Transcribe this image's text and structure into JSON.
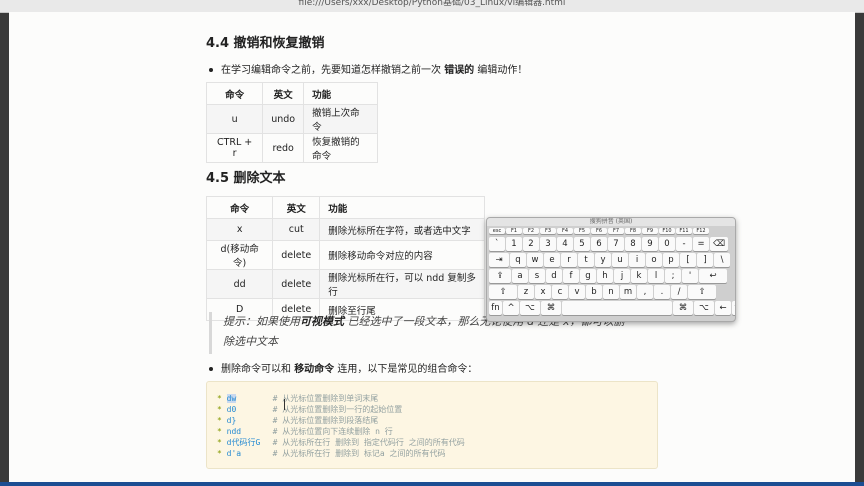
{
  "browser": {
    "url": "file:///Users/xxx/Desktop/Python基础/03_Linux/vi编辑器.html"
  },
  "section44": {
    "title": "4.4 撤销和恢复撤销",
    "bullet_pre": "在学习编辑命令之前，先要知道怎样撤销之前一次",
    "bullet_bold": "错误的",
    "bullet_post": "编辑动作！",
    "headers": [
      "命令",
      "英文",
      "功能"
    ],
    "rows": [
      [
        "u",
        "undo",
        "撤销上次命令"
      ],
      [
        "CTRL + r",
        "redo",
        "恢复撤销的命令"
      ]
    ]
  },
  "section45": {
    "title": "4.5 删除文本",
    "headers": [
      "命令",
      "英文",
      "功能"
    ],
    "rows": [
      [
        "x",
        "cut",
        "删除光标所在字符，或者选中文字"
      ],
      [
        "d(移动命令)",
        "delete",
        "删除移动命令对应的内容"
      ],
      [
        "dd",
        "delete",
        "删除光标所在行，可以 ndd 复制多行"
      ],
      [
        "D",
        "delete",
        "删除至行尾"
      ]
    ],
    "tip": {
      "p1": "提示：如果使用",
      "b1": "可视模式",
      "p2": "已经选中了一段文本，那么无论使用",
      "c1": "d",
      "p3": "还是",
      "c2": "x",
      "p4": "，都可以删",
      "p5": "除选中文本"
    },
    "bullet2_pre": "删除命令可以和",
    "bullet2_bold": "移动命令",
    "bullet2_post": "连用，以下是常见的组合命令：",
    "code": [
      {
        "cmd": "dw",
        "comment": "# 从光标位置删除到单词末尾"
      },
      {
        "cmd": "d0",
        "comment": "# 从光标位置删除到一行的起始位置"
      },
      {
        "cmd": "d}",
        "comment": "# 从光标位置删除到段落结尾"
      },
      {
        "cmd": "ndd",
        "comment": "# 从光标位置向下连续删除 n 行"
      },
      {
        "cmd": "d代码行G",
        "comment": "# 从光标所在行 删除到 指定代码行 之间的所有代码"
      },
      {
        "cmd": "d'a",
        "comment": "# 从光标所在行 删除到 标记a 之间的所有代码"
      }
    ]
  },
  "keyboard": {
    "title": "搜狗拼音 (英国)",
    "rows": [
      [
        "esc",
        "F1",
        "F2",
        "F3",
        "F4",
        "F5",
        "F6",
        "F7",
        "F8",
        "F9",
        "F10",
        "F11",
        "F12"
      ],
      [
        "`",
        "1",
        "2",
        "3",
        "4",
        "5",
        "6",
        "7",
        "8",
        "9",
        "0",
        "-",
        "=",
        "⌫"
      ],
      [
        "⇥",
        "q",
        "w",
        "e",
        "r",
        "t",
        "y",
        "u",
        "i",
        "o",
        "p",
        "[",
        "]",
        "\\"
      ],
      [
        "⇪",
        "a",
        "s",
        "d",
        "f",
        "g",
        "h",
        "j",
        "k",
        "l",
        ";",
        "'",
        "↩"
      ],
      [
        "⇧",
        "z",
        "x",
        "c",
        "v",
        "b",
        "n",
        "m",
        ",",
        ".",
        "/",
        "⇧"
      ],
      [
        "fn",
        "^",
        "⌥",
        "⌘",
        "",
        "⌘",
        "⌥",
        "←",
        "↑↓",
        "→"
      ]
    ]
  }
}
